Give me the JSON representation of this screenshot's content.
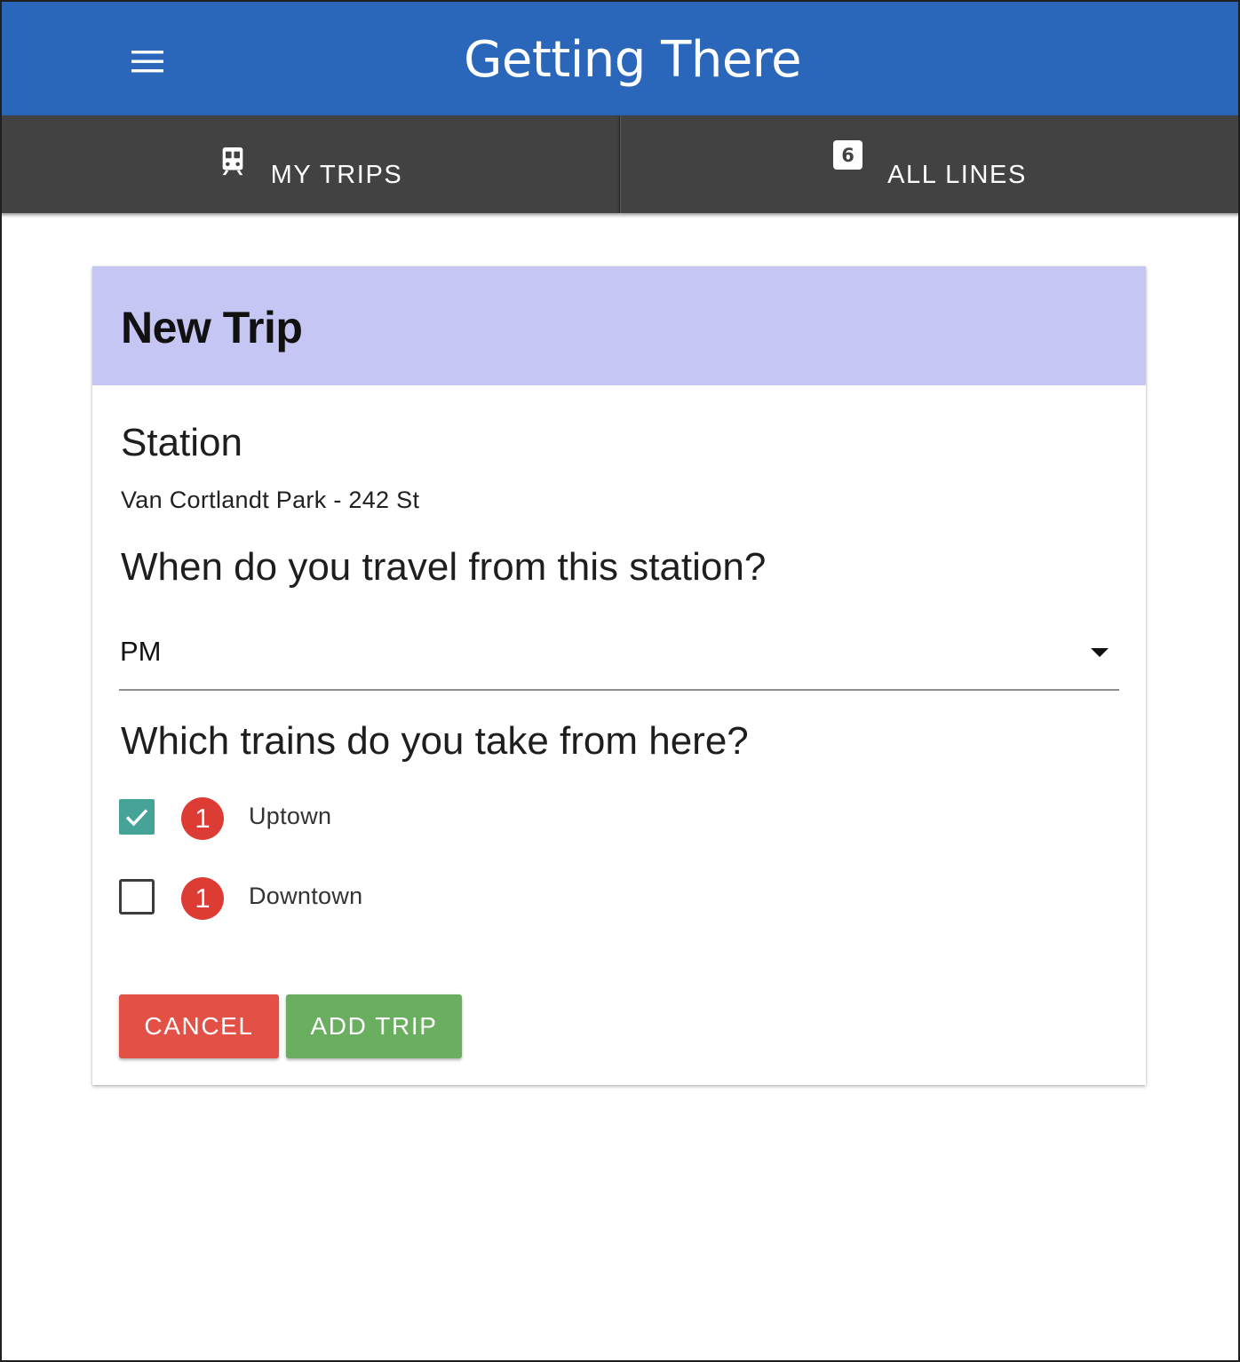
{
  "app": {
    "title": "Getting There",
    "menu_icon": "hamburger-menu-icon"
  },
  "tabs": [
    {
      "label": "MY TRIPS",
      "icon": "train-icon"
    },
    {
      "label": "ALL LINES",
      "icon": "line-badge-icon",
      "badge_text": "6"
    }
  ],
  "card": {
    "title": "New Trip",
    "header_color": "#c5c6f4",
    "station_label": "Station",
    "station_value": "Van Cortlandt Park - 242 St",
    "time_question": "When do you travel from this station?",
    "time_selected": "PM",
    "trains_question": "Which trains do you take from here?",
    "trains": [
      {
        "route": "1",
        "direction": "Uptown",
        "checked": true
      },
      {
        "route": "1",
        "direction": "Downtown",
        "checked": false
      }
    ],
    "cancel_label": "CANCEL",
    "add_label": "ADD TRIP"
  },
  "colors": {
    "appbar": "#2a67bb",
    "tabs": "#424242",
    "route_1": "#dc3c33",
    "checkbox_checked": "#46a398",
    "cancel": "#e35045",
    "add": "#6aaf5f"
  }
}
